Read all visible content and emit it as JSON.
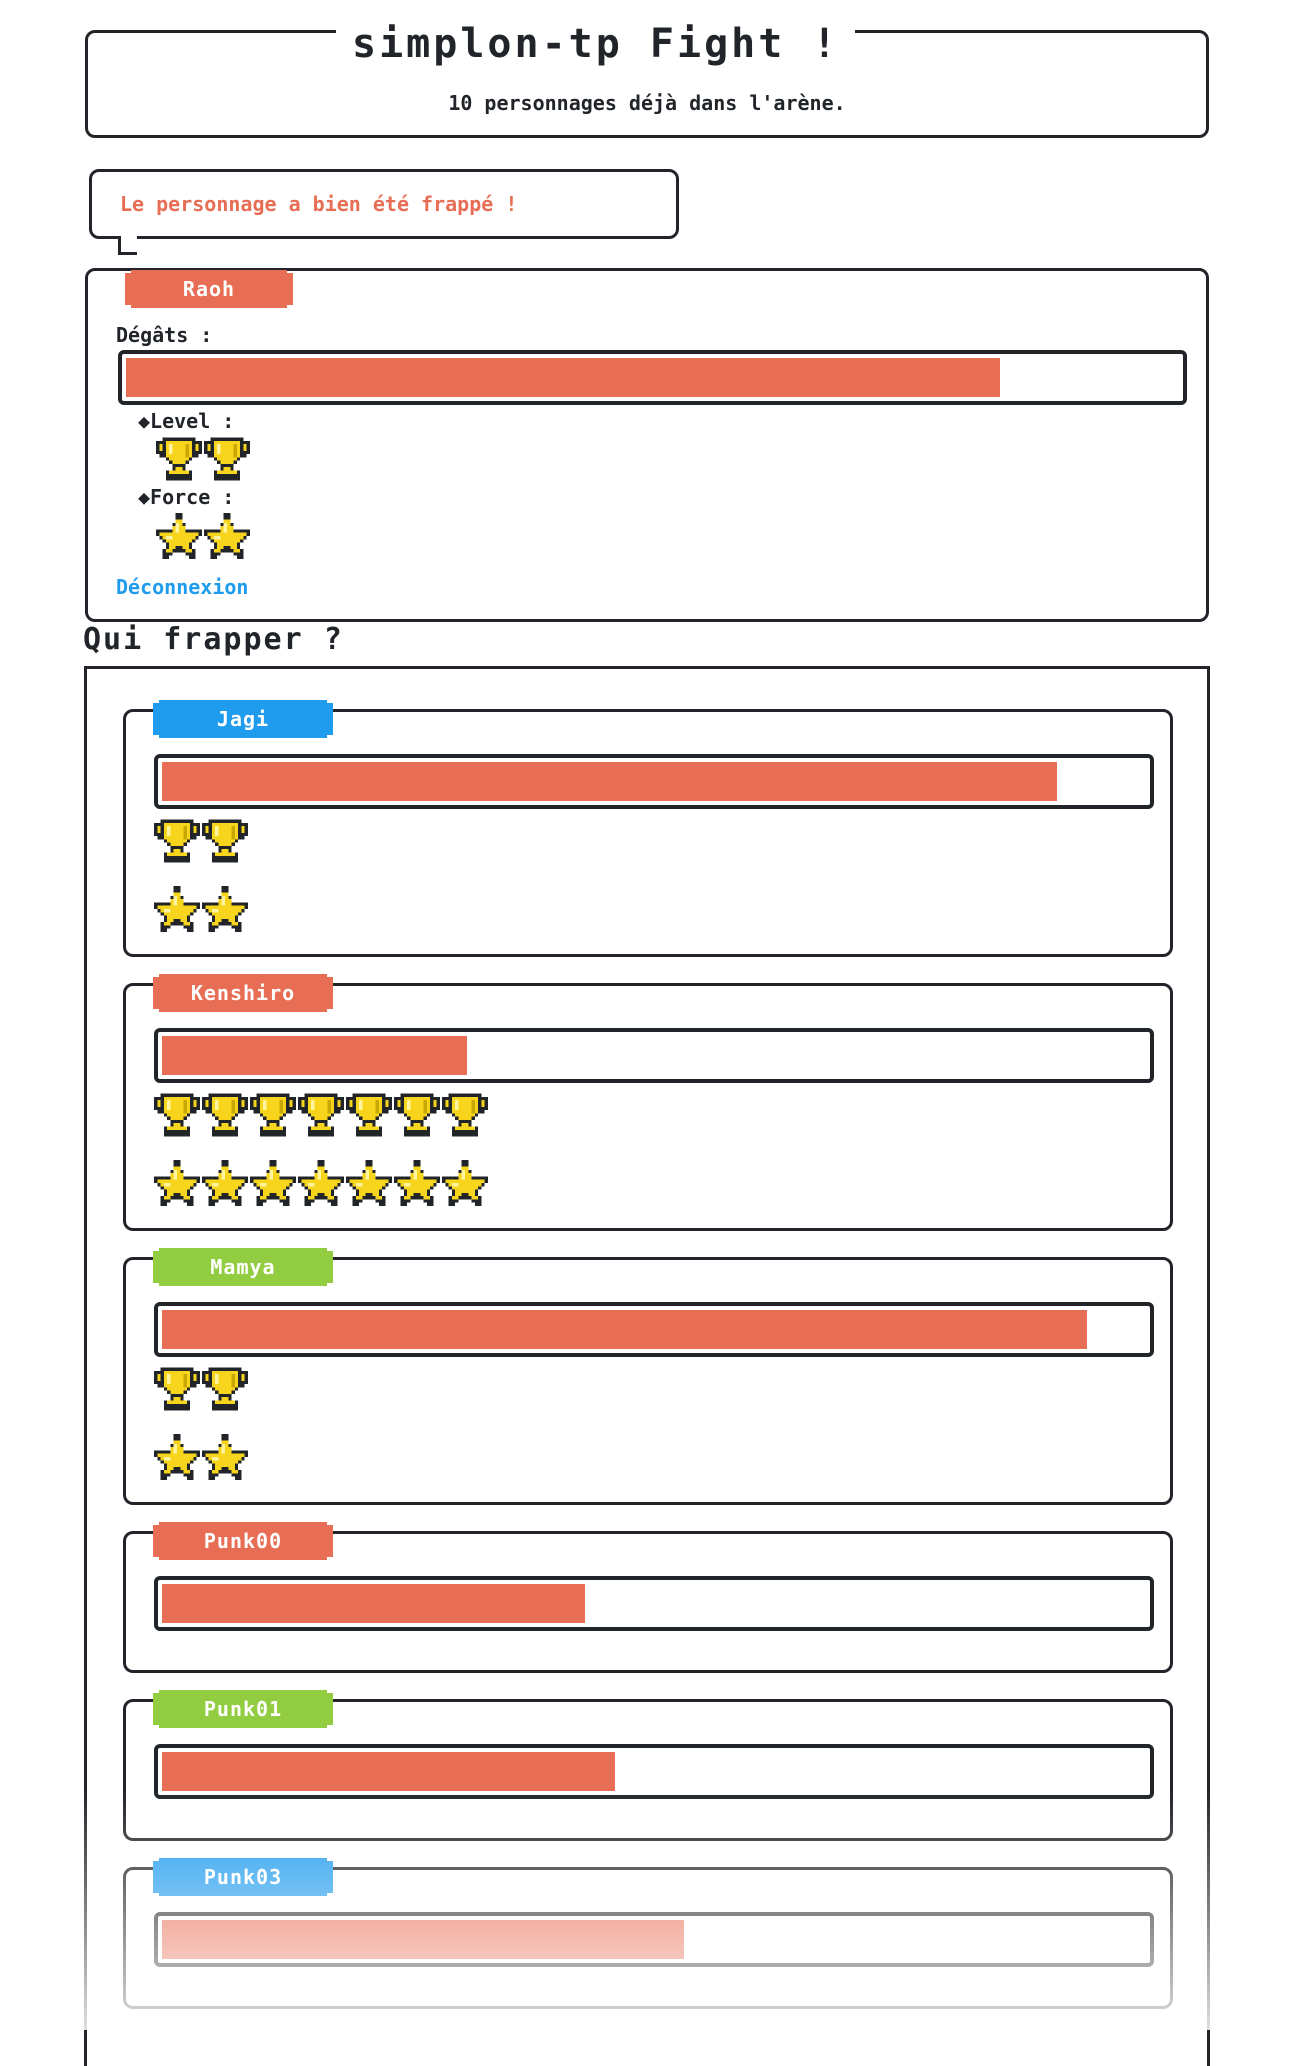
{
  "header": {
    "title": "simplon-tp Fight !",
    "subtitle": "10 personnages déjà dans l'arène."
  },
  "message": "Le personnage a bien été frappé !",
  "player": {
    "name": "Raoh",
    "damage_label": "Dégâts :",
    "damage_fraction": 0.83,
    "level_label": "Level :",
    "level": 2,
    "force_label": "Force :",
    "force": 2,
    "logout_label": "Déconnexion"
  },
  "targets_title": "Qui frapper ?",
  "targets": [
    {
      "name": "Jagi",
      "color": "#209cee",
      "damage_fraction": 0.91,
      "level": 2,
      "force": 2
    },
    {
      "name": "Kenshiro",
      "color": "#e76e55",
      "damage_fraction": 0.31,
      "level": 7,
      "force": 7
    },
    {
      "name": "Mamya",
      "color": "#92cc41",
      "damage_fraction": 0.94,
      "level": 2,
      "force": 2
    },
    {
      "name": "Punk00",
      "color": "#e76e55",
      "damage_fraction": 0.43,
      "level": 0,
      "force": 0
    },
    {
      "name": "Punk01",
      "color": "#92cc41",
      "damage_fraction": 0.46,
      "level": 0,
      "force": 0
    },
    {
      "name": "Punk03",
      "color": "#209cee",
      "damage_fraction": 0.53,
      "level": 0,
      "force": 0
    }
  ],
  "colors": {
    "accent_red": "#e76e55",
    "link_blue": "#209cee",
    "text": "#212529"
  },
  "icons": {
    "level": "trophy-icon",
    "force": "star-icon"
  }
}
